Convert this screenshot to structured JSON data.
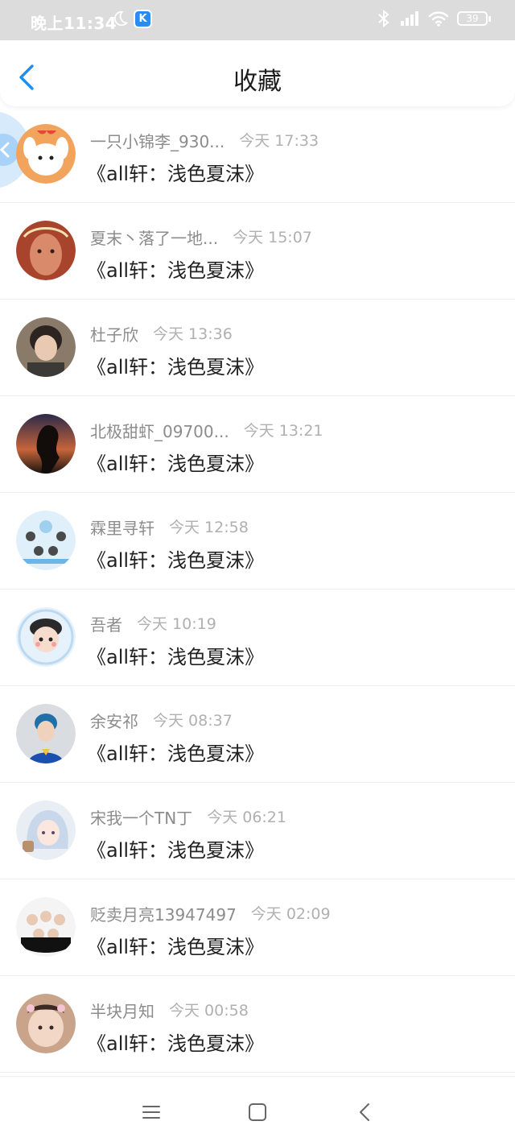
{
  "status_bar": {
    "time": "晚上11:34",
    "battery": "39",
    "app_badge": "K"
  },
  "header": {
    "title": "收藏"
  },
  "colors": {
    "accent": "#1e8ef0",
    "status_bar_bg": "#dcdcdc",
    "name_text": "#8c8c8c",
    "time_text": "#b0b0b0",
    "work_text": "#222222"
  },
  "favorites": [
    {
      "name": "一只小锦李_930...",
      "time": "今天 17:33",
      "work": "《all轩：浅色夏沫》"
    },
    {
      "name": "夏末丶落了一地...",
      "time": "今天 15:07",
      "work": "《all轩：浅色夏沫》"
    },
    {
      "name": "杜子欣",
      "time": "今天 13:36",
      "work": "《all轩：浅色夏沫》"
    },
    {
      "name": "北极甜虾_09700...",
      "time": "今天 13:21",
      "work": "《all轩：浅色夏沫》"
    },
    {
      "name": "霖里寻轩",
      "time": "今天 12:58",
      "work": "《all轩：浅色夏沫》"
    },
    {
      "name": "吾者",
      "time": "今天 10:19",
      "work": "《all轩：浅色夏沫》"
    },
    {
      "name": "余安祁",
      "time": "今天 08:37",
      "work": "《all轩：浅色夏沫》"
    },
    {
      "name": "宋我一个TN丁",
      "time": "今天 06:21",
      "work": "《all轩：浅色夏沫》"
    },
    {
      "name": "贬卖月亮13947497",
      "time": "今天 02:09",
      "work": "《all轩：浅色夏沫》"
    },
    {
      "name": "半块月知",
      "time": "今天 00:58",
      "work": "《all轩：浅色夏沫》"
    }
  ],
  "icons": {
    "back": "chevron-left-icon",
    "floating": "floating-back-icon",
    "nav_menu": "menu-icon",
    "nav_home": "home-square-icon",
    "nav_back": "nav-back-icon"
  }
}
